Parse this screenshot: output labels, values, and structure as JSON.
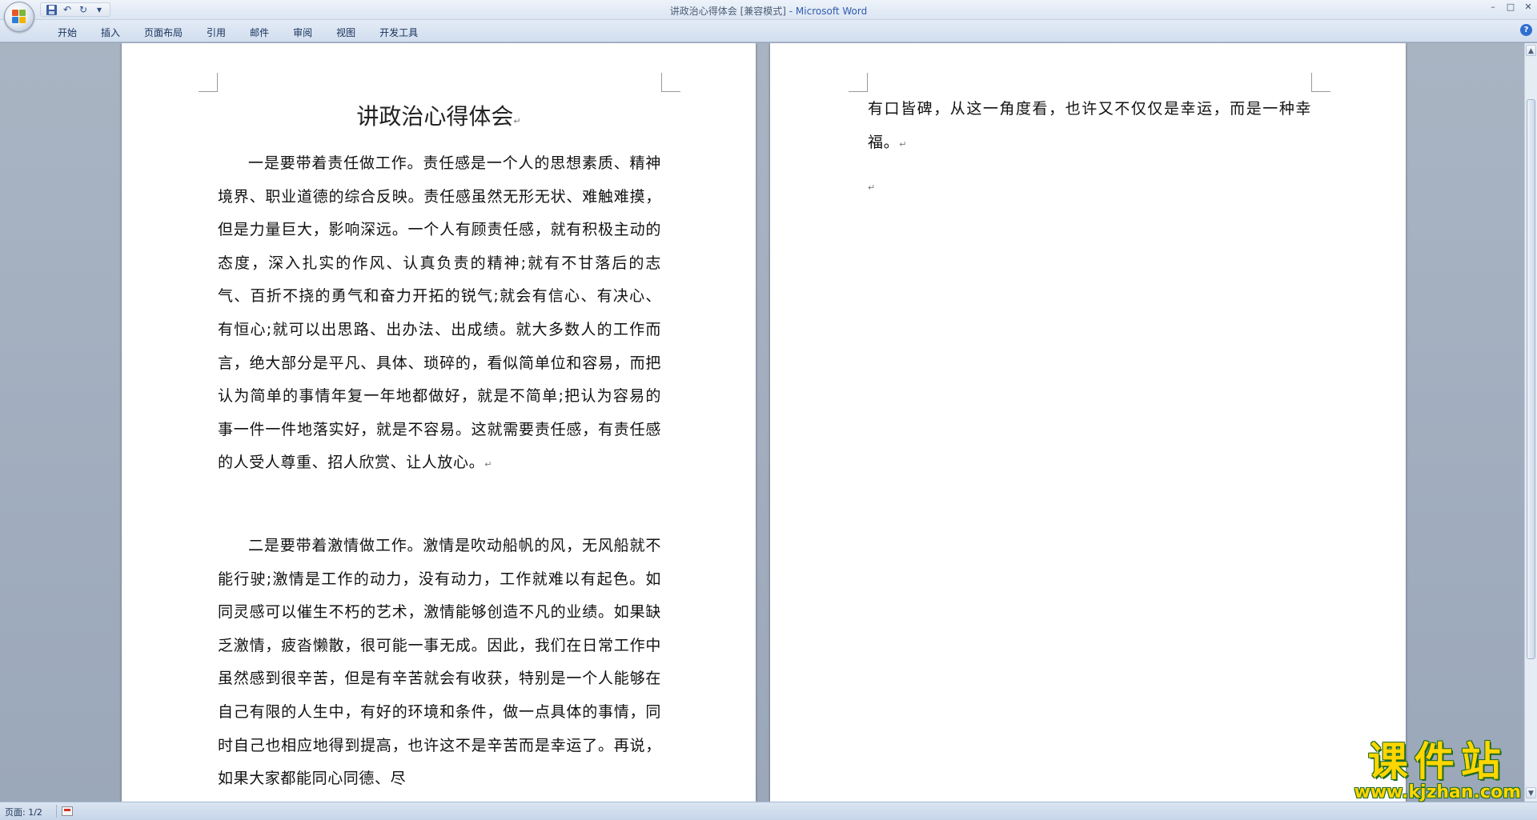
{
  "window": {
    "title": "讲政治心得体会 [兼容模式]",
    "app_suffix": " - Microsoft Word"
  },
  "qat": {
    "save": "save-icon",
    "undo": "↶",
    "redo": "↻",
    "customize": "▾"
  },
  "window_controls": {
    "minimize": "–",
    "maximize": "□",
    "close": "✕"
  },
  "ribbon": {
    "tabs": [
      "开始",
      "插入",
      "页面布局",
      "引用",
      "邮件",
      "审阅",
      "视图",
      "开发工具"
    ],
    "help": "?"
  },
  "document": {
    "title": "讲政治心得体会",
    "paragraph_mark": "↵",
    "paragraphs": [
      "一是要带着责任做工作。责任感是一个人的思想素质、精神境界、职业道德的综合反映。责任感虽然无形无状、难触难摸，但是力量巨大，影响深远。一个人有顾责任感，就有积极主动的态度，深入扎实的作风、认真负责的精神;就有不甘落后的志气、百折不挠的勇气和奋力开拓的锐气;就会有信心、有决心、有恒心;就可以出思路、出办法、出成绩。就大多数人的工作而言，绝大部分是平凡、具体、琐碎的，看似简单位和容易，而把认为简单的事情年复一年地都做好，就是不简单;把认为容易的事一件一件地落实好，就是不容易。这就需要责任感，有责任感的人受人尊重、招人欣赏、让人放心。",
      "二是要带着激情做工作。激情是吹动船帆的风，无风船就不能行驶;激情是工作的动力，没有动力，工作就难以有起色。如同灵感可以催生不朽的艺术，激情能够创造不凡的业绩。如果缺乏激情，疲沓懒散，很可能一事无成。因此，我们在日常工作中虽然感到很辛苦，但是有辛苦就会有收获，特别是一个人能够在自己有限的人生中，有好的环境和条件，做一点具体的事情，同时自己也相应地得到提高，也许这不是辛苦而是幸运了。再说，如果大家都能同心同德、尽",
      "有口皆碑，从这一角度看，也许又不仅仅是幸运，而是一种幸福。"
    ]
  },
  "statusbar": {
    "page": "页面: 1/2",
    "proofing": "proofing-icon"
  },
  "scrollbar": {
    "up": "▲",
    "down": "▼"
  },
  "watermark": {
    "main": "课件站",
    "sub": "www.kjzhan.com"
  }
}
